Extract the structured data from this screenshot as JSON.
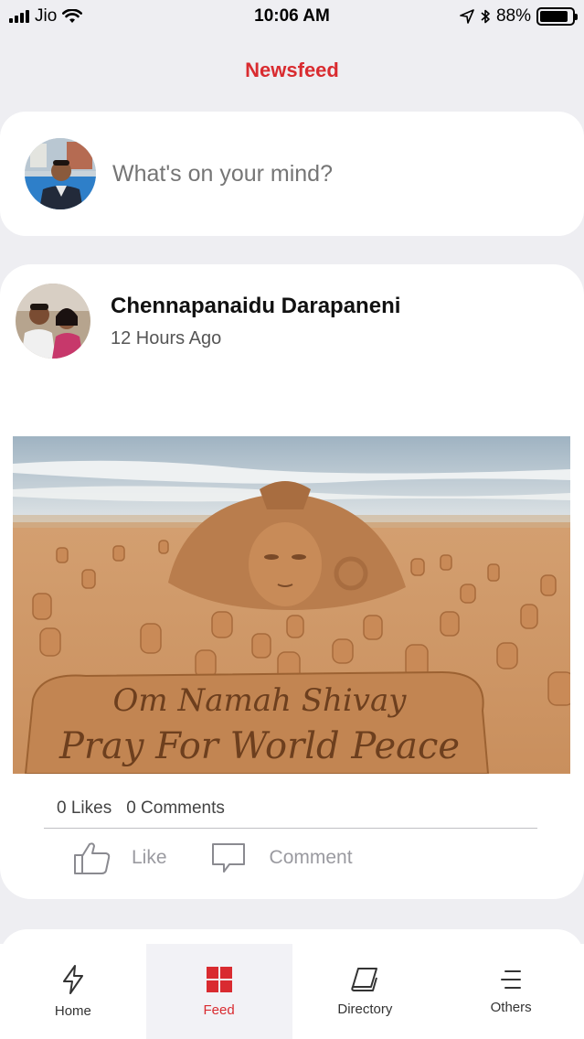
{
  "status_bar": {
    "carrier": "Jio",
    "time": "10:06 AM",
    "battery_percent": "88%",
    "battery_level": 0.88
  },
  "header": {
    "title": "Newsfeed"
  },
  "composer": {
    "placeholder": "What's on your mind?"
  },
  "post": {
    "author": "Chennapanaidu Darapaneni",
    "time_ago": "12 Hours Ago",
    "image_text_line1": "Om Namah Shivay",
    "image_text_line2": "Pray For World Peace",
    "likes": "0 Likes",
    "comments": "0 Comments",
    "like_label": "Like",
    "comment_label": "Comment"
  },
  "tabs": [
    {
      "label": "Home",
      "icon": "bolt-icon"
    },
    {
      "label": "Feed",
      "icon": "grid-icon"
    },
    {
      "label": "Directory",
      "icon": "book-icon"
    },
    {
      "label": "Others",
      "icon": "menu-icon"
    }
  ],
  "colors": {
    "accent": "#d92b30",
    "background": "#eeeef2",
    "card": "#ffffff"
  }
}
